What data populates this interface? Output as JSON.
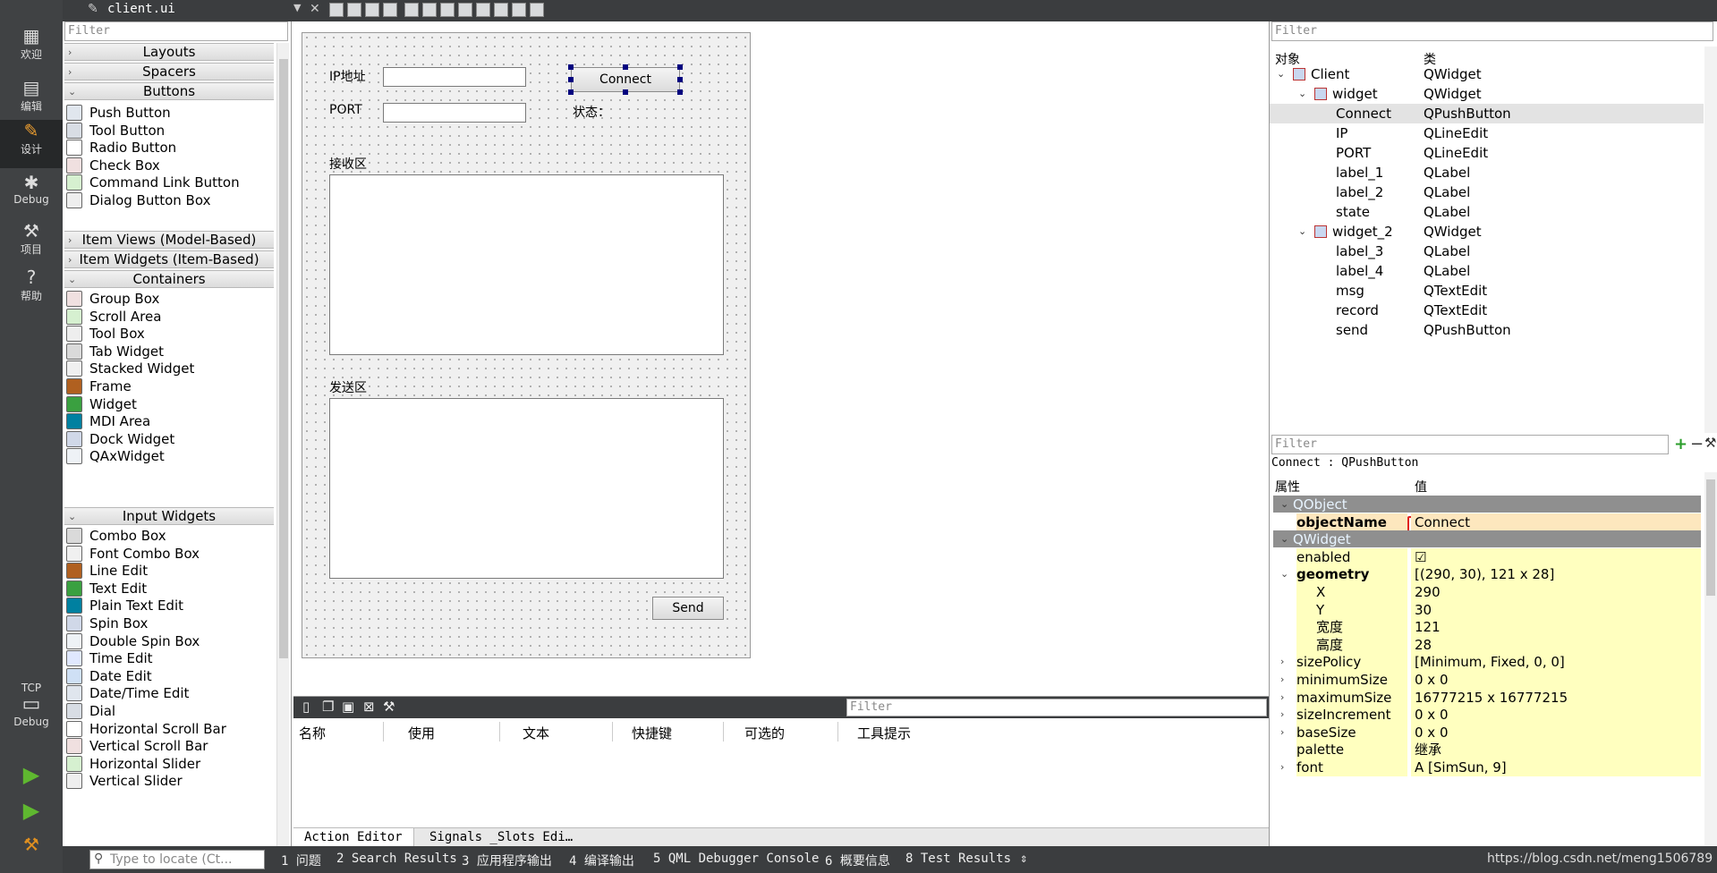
{
  "modes": [
    {
      "label": "欢迎",
      "icon": "grid-icon"
    },
    {
      "label": "编辑",
      "icon": "edit-icon"
    },
    {
      "label": "设计",
      "icon": "pencil-icon"
    },
    {
      "label": "Debug",
      "icon": "bug-icon"
    },
    {
      "label": "项目",
      "icon": "wrench-icon"
    },
    {
      "label": "帮助",
      "icon": "help-icon"
    }
  ],
  "kit": {
    "name": "TCP",
    "mode": "Debug"
  },
  "document": {
    "title": "client.ui"
  },
  "widget_box": {
    "filter_placeholder": "Filter",
    "categories": [
      "Layouts",
      "Spacers",
      "Buttons",
      "Item Views (Model-Based)",
      "Item Widgets (Item-Based)",
      "Containers",
      "Input Widgets"
    ],
    "buttons": [
      "Push Button",
      "Tool Button",
      "Radio Button",
      "Check Box",
      "Command Link Button",
      "Dialog Button Box"
    ],
    "containers": [
      "Group Box",
      "Scroll Area",
      "Tool Box",
      "Tab Widget",
      "Stacked Widget",
      "Frame",
      "Widget",
      "MDI Area",
      "Dock Widget",
      "QAxWidget"
    ],
    "inputs": [
      "Combo Box",
      "Font Combo Box",
      "Line Edit",
      "Text Edit",
      "Plain Text Edit",
      "Spin Box",
      "Double Spin Box",
      "Time Edit",
      "Date Edit",
      "Date/Time Edit",
      "Dial",
      "Horizontal Scroll Bar",
      "Vertical Scroll Bar",
      "Horizontal Slider",
      "Vertical Slider"
    ]
  },
  "form": {
    "ip_label": "IP地址",
    "port_label": "PORT",
    "connect_label": "Connect",
    "state_label": "状态：",
    "recv_label": "接收区",
    "send_area_label": "发送区",
    "send_label": "Send"
  },
  "action_editor": {
    "filter_placeholder": "Filter",
    "headers": [
      "名称",
      "使用",
      "文本",
      "快捷键",
      "可选的",
      "工具提示"
    ],
    "tabs": [
      "Action Editor",
      "Signals _Slots Edi…"
    ]
  },
  "object_inspector": {
    "filter_placeholder": "Filter",
    "col_object": "对象",
    "col_class": "类",
    "rows": [
      {
        "name": "Client",
        "cls": "QWidget"
      },
      {
        "name": "widget",
        "cls": "QWidget"
      },
      {
        "name": "Connect",
        "cls": "QPushButton"
      },
      {
        "name": "IP",
        "cls": "QLineEdit"
      },
      {
        "name": "PORT",
        "cls": "QLineEdit"
      },
      {
        "name": "label_1",
        "cls": "QLabel"
      },
      {
        "name": "label_2",
        "cls": "QLabel"
      },
      {
        "name": "state",
        "cls": "QLabel"
      },
      {
        "name": "widget_2",
        "cls": "QWidget"
      },
      {
        "name": "label_3",
        "cls": "QLabel"
      },
      {
        "name": "label_4",
        "cls": "QLabel"
      },
      {
        "name": "msg",
        "cls": "QTextEdit"
      },
      {
        "name": "record",
        "cls": "QTextEdit"
      },
      {
        "name": "send",
        "cls": "QPushButton"
      }
    ]
  },
  "property_editor": {
    "filter_placeholder": "Filter",
    "context": "Connect : QPushButton",
    "col_prop": "属性",
    "col_value": "值",
    "rows": [
      {
        "n": "QObject",
        "v": ""
      },
      {
        "n": "objectName",
        "v": "Connect"
      },
      {
        "n": "QWidget",
        "v": ""
      },
      {
        "n": "enabled",
        "v": "☑"
      },
      {
        "n": "geometry",
        "v": "[(290, 30), 121 x 28]"
      },
      {
        "n": "X",
        "v": "290"
      },
      {
        "n": "Y",
        "v": "30"
      },
      {
        "n": "宽度",
        "v": "121"
      },
      {
        "n": "高度",
        "v": "28"
      },
      {
        "n": "sizePolicy",
        "v": "[Minimum, Fixed, 0, 0]"
      },
      {
        "n": "minimumSize",
        "v": "0 x 0"
      },
      {
        "n": "maximumSize",
        "v": "16777215 x 16777215"
      },
      {
        "n": "sizeIncrement",
        "v": "0 x 0"
      },
      {
        "n": "baseSize",
        "v": "0 x 0"
      },
      {
        "n": "palette",
        "v": "继承"
      },
      {
        "n": "font",
        "v": "A [SimSun, 9]"
      }
    ]
  },
  "status_bar": {
    "locate_placeholder": "Type to locate (Ct...",
    "items": [
      "1 问题",
      "2 Search Results",
      "3 应用程序输出",
      "4 编译输出",
      "5 QML Debugger Console",
      "6 概要信息",
      "8 Test Results"
    ],
    "watermark": "https://blog.csdn.net/meng1506789"
  },
  "colors": {
    "highlight_box": "#e02020",
    "section": "#8f8f8f",
    "prop_yellow": "#ffffbf"
  }
}
